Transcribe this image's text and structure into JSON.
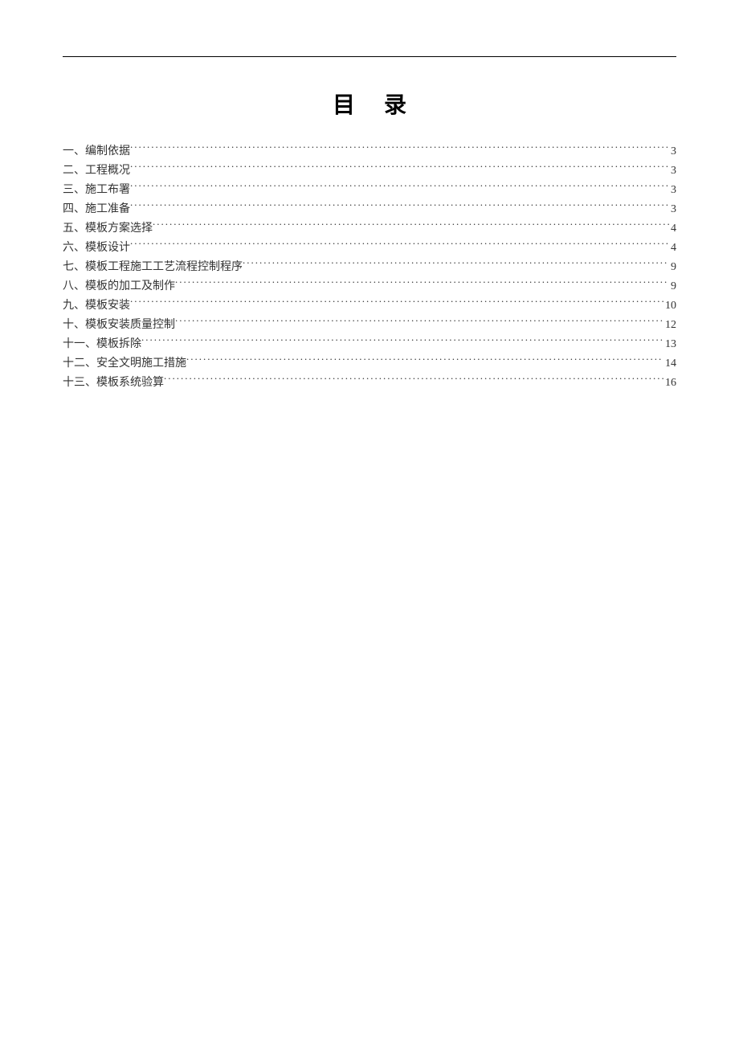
{
  "title": "目录",
  "toc": [
    {
      "label": "一、编制依据",
      "page": "3"
    },
    {
      "label": "二、工程概况",
      "page": "3"
    },
    {
      "label": "三、施工布署",
      "page": "3"
    },
    {
      "label": "四、施工准备",
      "page": "3"
    },
    {
      "label": "五、模板方案选择",
      "page": "4"
    },
    {
      "label": "六、模板设计",
      "page": "4"
    },
    {
      "label": "七、模板工程施工工艺流程控制程序",
      "page": "9"
    },
    {
      "label": "八、模板的加工及制作",
      "page": "9"
    },
    {
      "label": "九、模板安装",
      "page": "10"
    },
    {
      "label": "十、模板安装质量控制",
      "page": "12"
    },
    {
      "label": "十一、模板拆除",
      "page": "13"
    },
    {
      "label": "十二、安全文明施工措施",
      "page": "14"
    },
    {
      "label": "十三、模板系统验算",
      "page": "16"
    }
  ]
}
